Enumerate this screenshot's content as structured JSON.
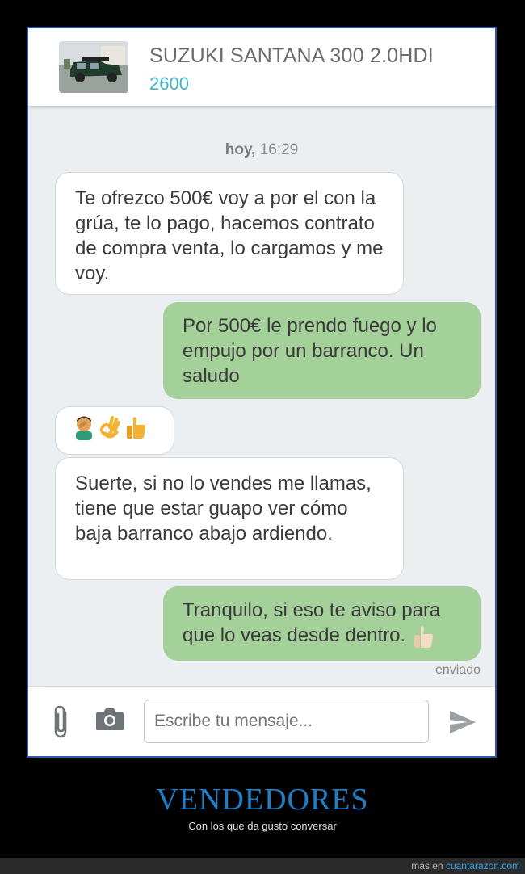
{
  "listing": {
    "title": "SUZUKI SANTANA 300 2.0HDI",
    "price": "2600"
  },
  "chat": {
    "date_label": "hoy,",
    "time": "16:29",
    "messages": [
      {
        "from": "buyer",
        "text": "Te ofrezco 500€ voy a por el con la grúa, te lo pago, hacemos contrato de compra venta, lo cargamos y me voy."
      },
      {
        "from": "seller",
        "text": "Por 500€ le prendo fuego y lo empujo por un barranco. Un saludo"
      },
      {
        "from": "buyer",
        "emojis": [
          "facepalm-icon",
          "ok-hand-icon",
          "thumbs-up-icon"
        ]
      },
      {
        "from": "buyer",
        "text": "Suerte, si no lo vendes me llamas, tiene que estar guapo ver cómo baja barranco abajo ardiendo."
      },
      {
        "from": "seller",
        "text": "Tranquilo, si eso te aviso para que lo veas desde dentro.",
        "emoji": "thumbs-up-icon"
      }
    ],
    "status": "enviado"
  },
  "composer": {
    "placeholder": "Escribe tu mensaje..."
  },
  "caption": {
    "title": "VENDEDORES",
    "subtitle": "Con los que da gusto conversar"
  },
  "footer": {
    "prefix": "más en",
    "site": "cuantarazon.com"
  },
  "colors": {
    "accent": "#3fb3c9",
    "outgoing_bubble": "#a4d19a",
    "caption": "#1d7ec6"
  }
}
